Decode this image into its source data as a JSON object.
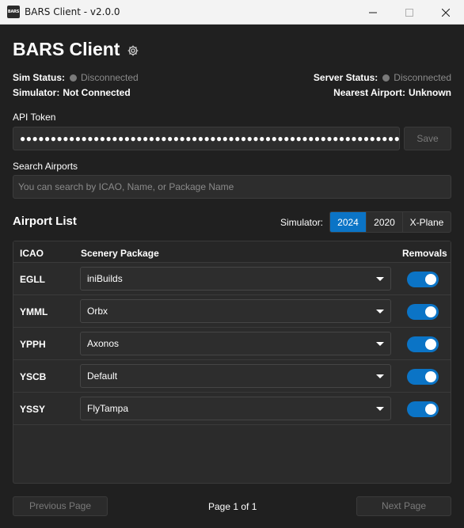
{
  "window": {
    "title": "BARS Client - v2.0.0",
    "icon_text": "BARS"
  },
  "header": {
    "title": "BARS Client",
    "settings_icon": "gear-icon"
  },
  "status": {
    "sim_status_label": "Sim Status:",
    "sim_status_value": "Disconnected",
    "simulator_label": "Simulator:",
    "simulator_value": "Not Connected",
    "server_status_label": "Server Status:",
    "server_status_value": "Disconnected",
    "nearest_airport_label": "Nearest Airport:",
    "nearest_airport_value": "Unknown"
  },
  "api_token": {
    "label": "API Token",
    "value": "●●●●●●●●●●●●●●●●●●●●●●●●●●●●●●●●●●●●●●●●●●●●●●●●●●●●●●●●●●●●●●●●●●●●●●●●●",
    "save_label": "Save"
  },
  "search": {
    "label": "Search Airports",
    "placeholder": "You can search by ICAO, Name, or Package Name",
    "value": ""
  },
  "airport_list": {
    "title": "Airport List",
    "simulator_label": "Simulator:",
    "simulators": [
      "2024",
      "2020",
      "X-Plane"
    ],
    "selected_simulator": "2024",
    "columns": {
      "icao": "ICAO",
      "package": "Scenery Package",
      "removals": "Removals"
    },
    "rows": [
      {
        "icao": "EGLL",
        "package": "iniBuilds",
        "removals": true
      },
      {
        "icao": "YMML",
        "package": "Orbx",
        "removals": true
      },
      {
        "icao": "YPPH",
        "package": "Axonos",
        "removals": true
      },
      {
        "icao": "YSCB",
        "package": "Default",
        "removals": true
      },
      {
        "icao": "YSSY",
        "package": "FlyTampa",
        "removals": true
      }
    ]
  },
  "pagination": {
    "previous_label": "Previous Page",
    "next_label": "Next Page",
    "page_info": "Page 1 of 1"
  },
  "colors": {
    "accent": "#0b74c6",
    "background": "#202020",
    "status_dot": "#7a7a7a"
  }
}
